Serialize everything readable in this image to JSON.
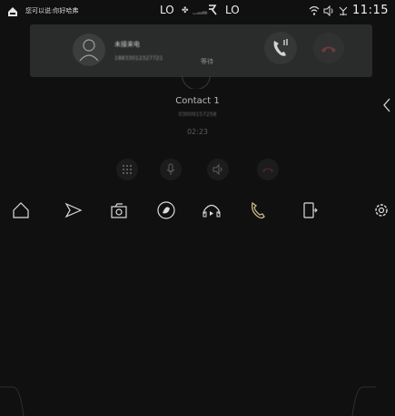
{
  "status_bar": {
    "voice_hint": "您可以说:你好哈弗",
    "left_temp": "LO",
    "right_temp": "LO",
    "time": "11:15"
  },
  "incoming_card": {
    "contact_name": "未接来电",
    "phone_number": "18833012327721",
    "status": "等待"
  },
  "call": {
    "contact_name": "Contact 1",
    "phone_number": "03009157258",
    "timer": "02:23"
  },
  "colors": {
    "background": "#101010",
    "card": "#2a2c2c",
    "accept_green": "#bdbdbd",
    "hangup_red": "#5a2c2c",
    "active_nav": "#c8b98a"
  }
}
